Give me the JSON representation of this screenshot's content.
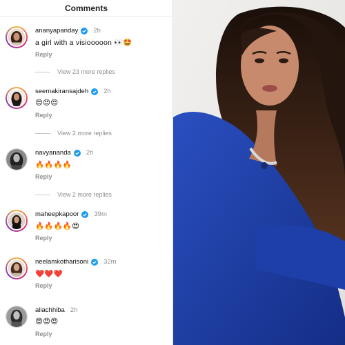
{
  "header": {
    "title": "Comments"
  },
  "comments": [
    {
      "username": "ananyapanday",
      "time": "2h",
      "text": "a girl with a visiooooon 👀🤩",
      "reply": "Reply",
      "more": "View 23 more replies",
      "verified": true
    },
    {
      "username": "seemakiransajdeh",
      "time": "2h",
      "text": "😍😍😍",
      "reply": "Reply",
      "more": "View 2 more replies",
      "verified": true
    },
    {
      "username": "navyananda",
      "time": "2h",
      "text": "🔥🔥🔥🔥",
      "reply": "Reply",
      "more": "View 2 more replies",
      "verified": true
    },
    {
      "username": "maheepkapoor",
      "time": "39m",
      "text": "🔥🔥🔥🔥😍",
      "reply": "Reply",
      "verified": true
    },
    {
      "username": "neelamkotharisoni",
      "time": "32m",
      "text": "❤️❤️❤️",
      "reply": "Reply",
      "verified": true
    },
    {
      "username": "aliachhiba",
      "time": "2h",
      "text": "😍😍😍",
      "reply": "Reply",
      "verified": false
    }
  ],
  "colors": {
    "verified": "#1d9bf0",
    "dress": "#1f3fa8",
    "hair": "#2a1a12"
  },
  "icons": {
    "verified": "verified-badge-icon"
  }
}
